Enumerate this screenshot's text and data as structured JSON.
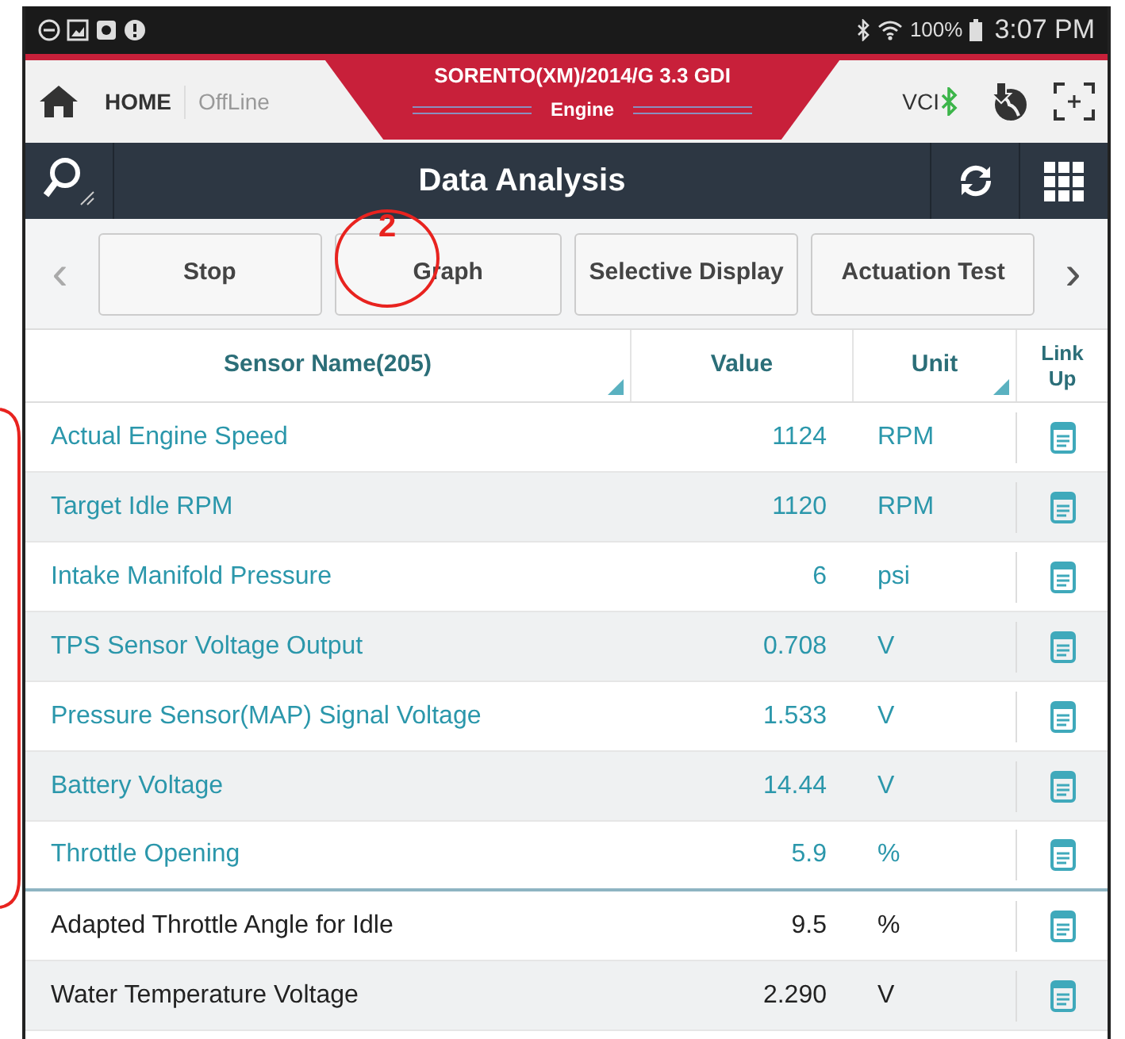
{
  "status_bar": {
    "battery": "100%",
    "time": "3:07 PM"
  },
  "header": {
    "home": "HOME",
    "mode": "OffLine",
    "vehicle": "SORENTO(XM)/2014/G 3.3 GDI",
    "system": "Engine",
    "vci": "VCI"
  },
  "title_bar": {
    "title": "Data Analysis"
  },
  "toolbar": {
    "prev_arrow": "‹",
    "next_arrow": "›",
    "buttons": [
      "Stop",
      "Graph",
      "Selective Display",
      "Actuation Test"
    ]
  },
  "table": {
    "columns": [
      "Sensor Name(205)",
      "Value",
      "Unit",
      "Link Up"
    ],
    "rows": [
      {
        "name": "Actual Engine Speed",
        "value": "1124",
        "unit": "RPM",
        "pinned": true
      },
      {
        "name": "Target Idle RPM",
        "value": "1120",
        "unit": "RPM",
        "pinned": true
      },
      {
        "name": "Intake Manifold Pressure",
        "value": "6",
        "unit": "psi",
        "pinned": true
      },
      {
        "name": "TPS Sensor Voltage Output",
        "value": "0.708",
        "unit": "V",
        "pinned": true
      },
      {
        "name": "Pressure Sensor(MAP) Signal Voltage",
        "value": "1.533",
        "unit": "V",
        "pinned": true
      },
      {
        "name": "Battery Voltage",
        "value": "14.44",
        "unit": "V",
        "pinned": true
      },
      {
        "name": "Throttle Opening",
        "value": "5.9",
        "unit": "%",
        "pinned": true
      },
      {
        "name": "Adapted Throttle Angle for Idle",
        "value": "9.5",
        "unit": "%",
        "pinned": false
      },
      {
        "name": "Water Temperature Voltage",
        "value": "2.290",
        "unit": "V",
        "pinned": false
      }
    ]
  },
  "annotation": {
    "label": "2"
  }
}
